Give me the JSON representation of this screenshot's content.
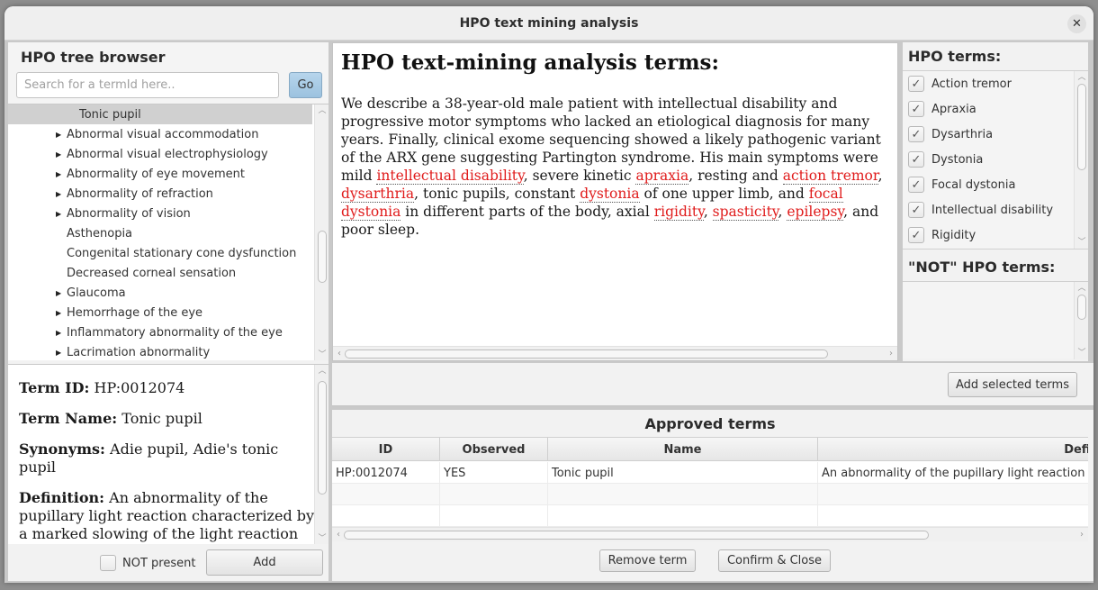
{
  "window": {
    "title": "HPO text mining analysis",
    "close_icon": "close-icon"
  },
  "tree_browser": {
    "title": "HPO tree browser",
    "search_placeholder": "Search for a termId here..",
    "search_value": "",
    "go_label": "Go",
    "items": [
      {
        "label": "Tonic pupil",
        "expandable": false,
        "selected": true,
        "indent": 2
      },
      {
        "label": "Abnormal visual accommodation",
        "expandable": true,
        "selected": false,
        "indent": 1
      },
      {
        "label": "Abnormal visual electrophysiology",
        "expandable": true,
        "selected": false,
        "indent": 1
      },
      {
        "label": "Abnormality of eye movement",
        "expandable": true,
        "selected": false,
        "indent": 1
      },
      {
        "label": "Abnormality of refraction",
        "expandable": true,
        "selected": false,
        "indent": 1
      },
      {
        "label": "Abnormality of vision",
        "expandable": true,
        "selected": false,
        "indent": 1
      },
      {
        "label": "Asthenopia",
        "expandable": false,
        "selected": false,
        "indent": 1
      },
      {
        "label": "Congenital stationary cone dysfunction",
        "expandable": false,
        "selected": false,
        "indent": 1
      },
      {
        "label": "Decreased corneal sensation",
        "expandable": false,
        "selected": false,
        "indent": 1
      },
      {
        "label": "Glaucoma",
        "expandable": true,
        "selected": false,
        "indent": 1
      },
      {
        "label": "Hemorrhage of the eye",
        "expandable": true,
        "selected": false,
        "indent": 1
      },
      {
        "label": "Inflammatory abnormality of the eye",
        "expandable": true,
        "selected": false,
        "indent": 1
      },
      {
        "label": "Lacrimation abnormality",
        "expandable": true,
        "selected": false,
        "indent": 1
      }
    ]
  },
  "term_detail": {
    "id_label": "Term ID:",
    "id_value": "HP:0012074",
    "name_label": "Term Name:",
    "name_value": "Tonic pupil",
    "synonyms_label": "Synonyms:",
    "synonyms_value": "Adie pupil, Adie's tonic pupil",
    "definition_label": "Definition:",
    "definition_value": "An abnormality of the pupillary light reaction characterized by a marked slowing of the light reaction of",
    "not_present_label": "NOT present",
    "not_present_checked": false,
    "add_label": "Add"
  },
  "analysis": {
    "heading": "HPO text-mining analysis terms:",
    "segments": [
      {
        "text": "We describe a 38-year-old male patient with intellectual disability and progressive motor symptoms who lacked an etiological diagnosis for many years. Finally, clinical exome sequencing showed a likely pathogenic variant of the ARX gene suggesting Partington syndrome. His main symptoms were mild ",
        "hl": false
      },
      {
        "text": "intellectual disability",
        "hl": true
      },
      {
        "text": ", severe kinetic ",
        "hl": false
      },
      {
        "text": "apraxia",
        "hl": true
      },
      {
        "text": ", resting and ",
        "hl": false
      },
      {
        "text": "action tremor",
        "hl": true
      },
      {
        "text": ", ",
        "hl": false
      },
      {
        "text": "dysarthria",
        "hl": true
      },
      {
        "text": ", tonic pupils, constant ",
        "hl": false
      },
      {
        "text": "dystonia",
        "hl": true
      },
      {
        "text": " of one upper limb, and ",
        "hl": false
      },
      {
        "text": "focal dystonia",
        "hl": true
      },
      {
        "text": " in different parts of the body, axial ",
        "hl": false
      },
      {
        "text": "rigidity",
        "hl": true
      },
      {
        "text": ", ",
        "hl": false
      },
      {
        "text": "spasticity",
        "hl": true
      },
      {
        "text": ", ",
        "hl": false
      },
      {
        "text": "epilepsy",
        "hl": true
      },
      {
        "text": ", and poor sleep.",
        "hl": false
      }
    ],
    "highlight_color": "#e01b1b"
  },
  "hpo_terms": {
    "title": "HPO terms:",
    "items": [
      {
        "label": "Action tremor",
        "checked": true
      },
      {
        "label": "Apraxia",
        "checked": true
      },
      {
        "label": "Dysarthria",
        "checked": true
      },
      {
        "label": "Dystonia",
        "checked": true
      },
      {
        "label": "Focal dystonia",
        "checked": true
      },
      {
        "label": "Intellectual disability",
        "checked": true
      },
      {
        "label": "Rigidity",
        "checked": true
      }
    ]
  },
  "not_hpo_terms": {
    "title": "\"NOT\" HPO terms:",
    "items": []
  },
  "add_selected_label": "Add selected terms",
  "approved": {
    "title": "Approved terms",
    "columns": [
      "ID",
      "Observed",
      "Name",
      "Definition"
    ],
    "rows": [
      [
        "HP:0012074",
        "YES",
        "Tonic pupil",
        "An abnormality of the pupillary light reaction"
      ]
    ],
    "remove_label": "Remove term",
    "confirm_label": "Confirm & Close"
  }
}
